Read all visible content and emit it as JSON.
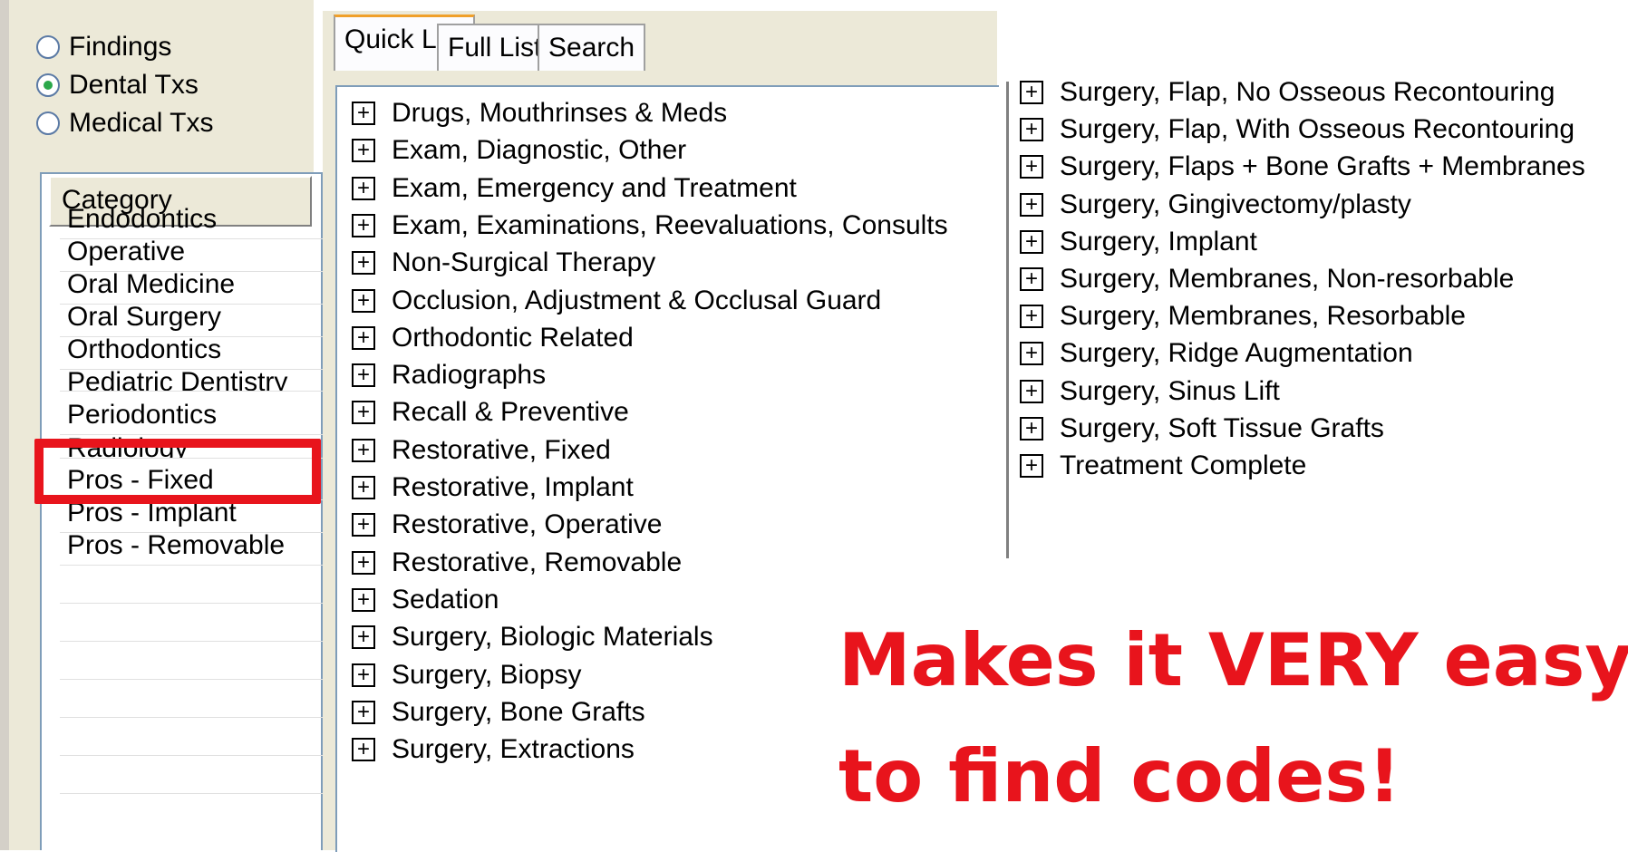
{
  "mode_radios": [
    {
      "label": "Findings",
      "selected": false
    },
    {
      "label": "Dental Txs",
      "selected": true
    },
    {
      "label": "Medical Txs",
      "selected": false
    }
  ],
  "category": {
    "header": "Category",
    "items": [
      "Endodontics",
      "Operative",
      "Oral Medicine",
      "Oral Surgery",
      "Orthodontics",
      "Pediatric Dentistry",
      "Periodontics",
      "Radiology",
      "Pros - Fixed",
      "Pros - Implant",
      "Pros - Removable"
    ],
    "selected": "Periodontics"
  },
  "tabs": [
    {
      "label": "Quick List",
      "active": true
    },
    {
      "label": "Full List",
      "active": false
    },
    {
      "label": "Search",
      "active": false
    }
  ],
  "quick_list_items": [
    "Drugs, Mouthrinses & Meds",
    "Exam, Diagnostic, Other",
    "Exam, Emergency and Treatment",
    "Exam, Examinations, Reevaluations, Consults",
    "Non-Surgical Therapy",
    "Occlusion, Adjustment & Occlusal Guard",
    "Orthodontic Related",
    "Radiographs",
    "Recall & Preventive",
    "Restorative, Fixed",
    "Restorative, Implant",
    "Restorative, Operative",
    "Restorative, Removable",
    "Sedation",
    "Surgery, Biologic Materials",
    "Surgery, Biopsy",
    "Surgery, Bone Grafts",
    "Surgery, Extractions"
  ],
  "continued_list_items": [
    "Surgery, Flap, No Osseous Recontouring",
    "Surgery, Flap, With Osseous Recontouring",
    "Surgery, Flaps + Bone Grafts + Membranes",
    "Surgery, Gingivectomy/plasty",
    "Surgery, Implant",
    "Surgery, Membranes, Non-resorbable",
    "Surgery, Membranes, Resorbable",
    "Surgery, Ridge Augmentation",
    "Surgery, Sinus Lift",
    "Surgery, Soft Tissue Grafts",
    "Treatment Complete"
  ],
  "expand_glyph": "+",
  "caption": {
    "line1": "Makes it VERY easy",
    "line2": "to find codes!"
  },
  "colors": {
    "highlight": "#e8141c",
    "caption": "#e8141c",
    "panel_bg": "#ece9d8",
    "radio_selected": "#2ba84a",
    "active_tab_accent": "#f0a02a"
  }
}
